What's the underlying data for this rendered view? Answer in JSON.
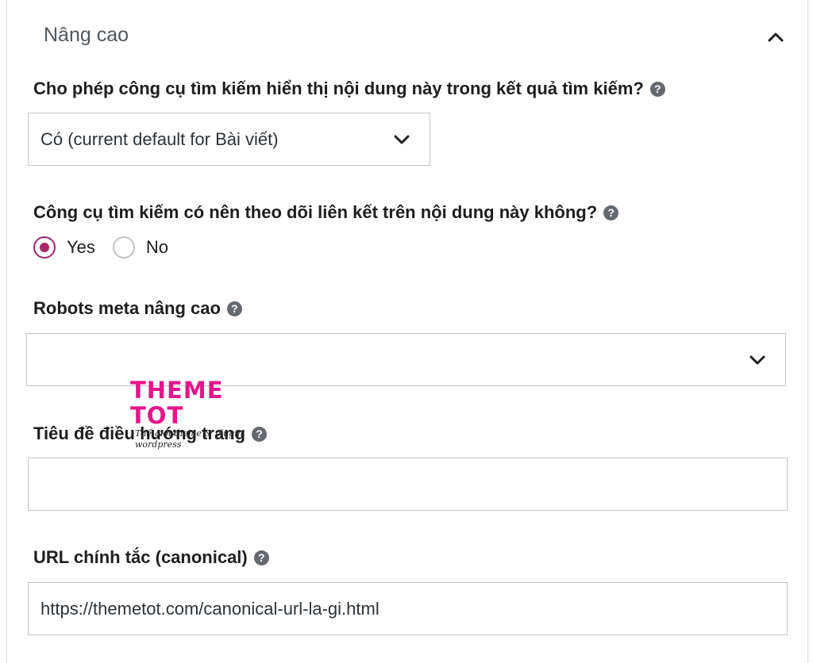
{
  "section": {
    "title": "Nâng cao"
  },
  "fields": {
    "search_visibility": {
      "label": "Cho phép công cụ tìm kiếm hiển thị nội dung này trong kết quả tìm kiếm?",
      "selected": "Có (current default for Bài viết)"
    },
    "follow_links": {
      "label": "Công cụ tìm kiếm có nên theo dõi liên kết trên nội dung này không?",
      "options": [
        "Yes",
        "No"
      ],
      "selected": "Yes"
    },
    "robots_meta": {
      "label": "Robots meta nâng cao",
      "selected": ""
    },
    "breadcrumb_title": {
      "label": "Tiêu đề điều hướng trang",
      "value": ""
    },
    "canonical_url": {
      "label": "URL chính tắc (canonical)",
      "value": "https://themetot.com/canonical-url-la-gi.html"
    }
  },
  "watermark": {
    "title": "THEME TOT",
    "subtitle": "Thế giới theme & plugin wordpress"
  },
  "help_glyph": "?",
  "colors": {
    "accent": "#a4286a",
    "watermark": "#e5158a",
    "help_icon": "#646970",
    "border": "#c3c4c7"
  }
}
